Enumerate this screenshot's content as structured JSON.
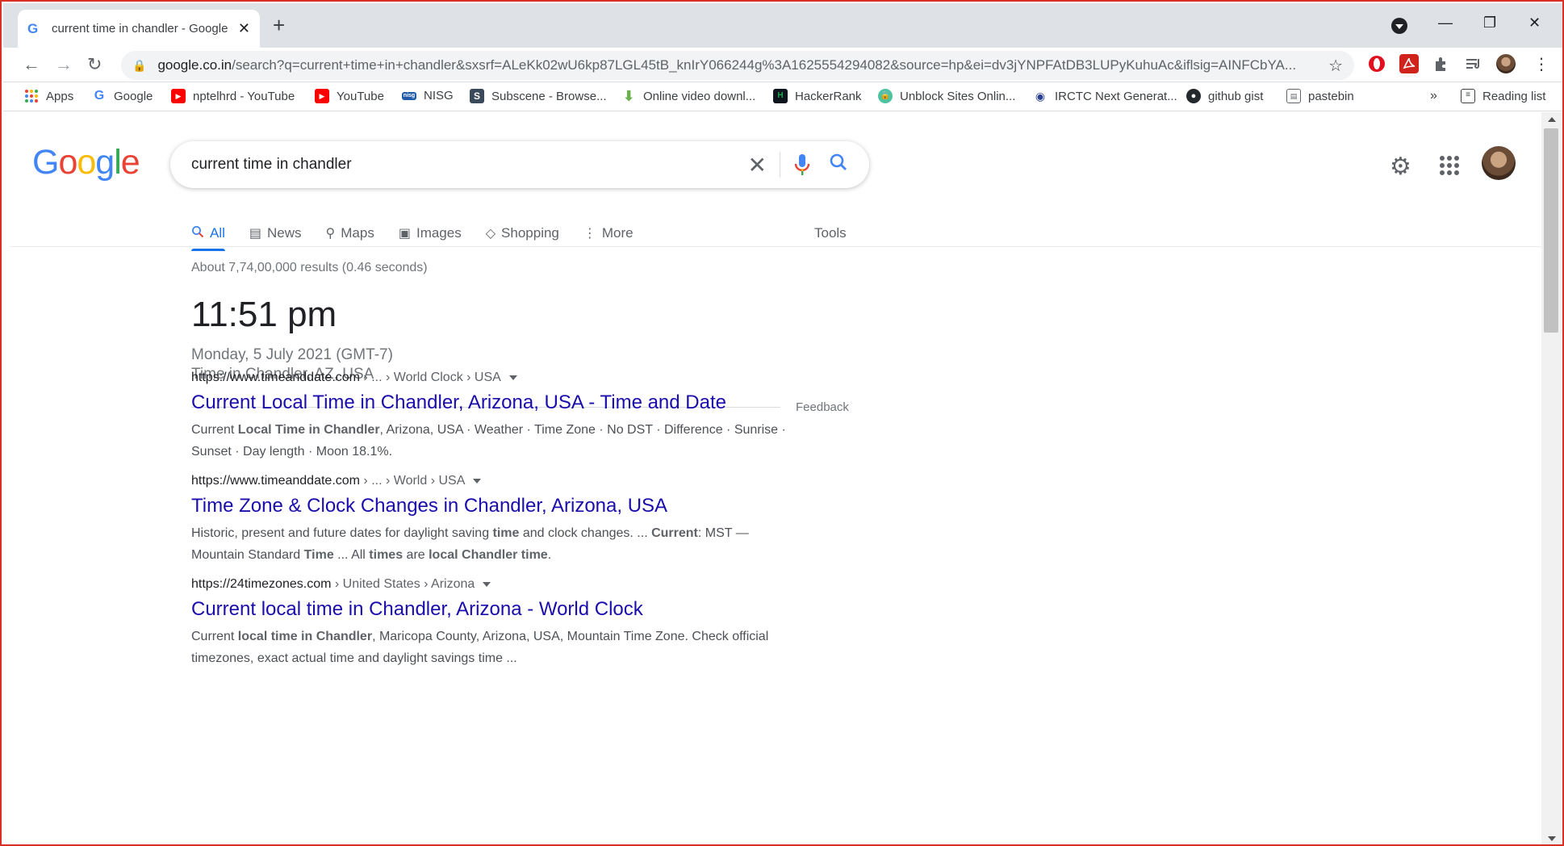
{
  "browser": {
    "tab_title": "current time in chandler - Google",
    "new_tab": "+",
    "url_host": "google.co.in",
    "url_path": "/search?q=current+time+in+chandler&sxsrf=ALeKk02wU6kp87LGL45tB_knIrY066244g%3A1625554294082&source=hp&ei=dv3jYNPFAtDB3LUPyKuhuAc&iflsig=AINFCbYA..."
  },
  "bookmarks": [
    {
      "label": "Apps",
      "icon": "apps-grid-icon",
      "color": "#ea4335"
    },
    {
      "label": "Google",
      "icon": "google-g-icon",
      "color": "#4285f4"
    },
    {
      "label": "nptelhrd - YouTube",
      "icon": "youtube-icon",
      "color": "#ff0000"
    },
    {
      "label": "YouTube",
      "icon": "youtube-icon",
      "color": "#ff0000"
    },
    {
      "label": "NISG",
      "icon": "nisg-icon",
      "color": "#1e5aa8"
    },
    {
      "label": "Subscene - Browse...",
      "icon": "subscene-icon",
      "color": "#3b4a5a"
    },
    {
      "label": "Online video downl...",
      "icon": "download-arrow-icon",
      "color": "#6ab04c"
    },
    {
      "label": "HackerRank",
      "icon": "hackerrank-icon",
      "color": "#1ba94c"
    },
    {
      "label": "Unblock Sites Onlin...",
      "icon": "unblock-lock-icon",
      "color": "#4fc3a1"
    },
    {
      "label": "IRCTC Next Generat...",
      "icon": "irctc-icon",
      "color": "#2a3f8f"
    },
    {
      "label": "github gist",
      "icon": "github-icon",
      "color": "#24292e"
    },
    {
      "label": "pastebin",
      "icon": "pastebin-icon",
      "color": "#5f6368"
    }
  ],
  "bookmarks_more": "»",
  "reading_list": "Reading list",
  "search": {
    "query": "current time in chandler",
    "tabs": [
      "All",
      "News",
      "Maps",
      "Images",
      "Shopping",
      "More"
    ],
    "tools": "Tools",
    "stats": "About 7,74,00,000 results (0.46 seconds)"
  },
  "time_card": {
    "time": "11:51 pm",
    "date": "Monday, 5 July 2021 (GMT-7)",
    "location": "Time in Chandler, AZ, USA",
    "feedback": "Feedback"
  },
  "results": [
    {
      "site": "https://www.timeanddate.com",
      "crumb": " › ... › World Clock › USA",
      "title": "Current Local Time in Chandler, Arizona, USA - Time and Date",
      "snippet_parts": [
        {
          "t": "Current ",
          "b": false
        },
        {
          "t": "Local Time in Chandler",
          "b": true
        },
        {
          "t": ", Arizona, USA · Weather · Time Zone · No DST · Difference · Sunrise · Sunset · Day length · Moon 18.1%.",
          "b": false
        }
      ]
    },
    {
      "site": "https://www.timeanddate.com",
      "crumb": " › ... › World › USA",
      "title": "Time Zone & Clock Changes in Chandler, Arizona, USA",
      "snippet_parts": [
        {
          "t": "Historic, present and future dates for daylight saving ",
          "b": false
        },
        {
          "t": "time",
          "b": true
        },
        {
          "t": " and clock changes. ... ",
          "b": false
        },
        {
          "t": "Current",
          "b": true
        },
        {
          "t": ": MST — Mountain Standard ",
          "b": false
        },
        {
          "t": "Time",
          "b": true
        },
        {
          "t": " ... All ",
          "b": false
        },
        {
          "t": "times",
          "b": true
        },
        {
          "t": " are ",
          "b": false
        },
        {
          "t": "local Chandler time",
          "b": true
        },
        {
          "t": ".",
          "b": false
        }
      ]
    },
    {
      "site": "https://24timezones.com",
      "crumb": " › United States › Arizona",
      "title": "Current local time in Chandler, Arizona - World Clock",
      "snippet_parts": [
        {
          "t": "Current ",
          "b": false
        },
        {
          "t": "local time in Chandler",
          "b": true
        },
        {
          "t": ", Maricopa County, Arizona, USA, Mountain Time Zone. Check official timezones, exact actual time and daylight savings time ...",
          "b": false
        }
      ]
    }
  ]
}
